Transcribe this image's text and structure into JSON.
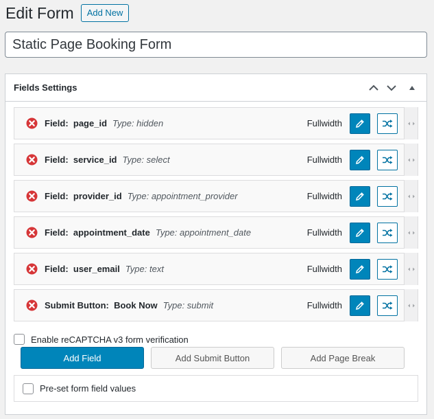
{
  "header": {
    "title": "Edit Form",
    "add_new_label": "Add New"
  },
  "form_name": {
    "value": "Static Page Booking Form"
  },
  "fields_panel": {
    "title": "Fields Settings",
    "icons": [
      "chevron-up-icon",
      "chevron-down-icon",
      "toggle-triangle-icon"
    ]
  },
  "fields": [
    {
      "label": "Field:  page_id",
      "type": "Type: hidden",
      "width": "Fullwidth"
    },
    {
      "label": "Field:  service_id",
      "type": "Type: select",
      "width": "Fullwidth"
    },
    {
      "label": "Field:  provider_id",
      "type": "Type: appointment_provider",
      "width": "Fullwidth"
    },
    {
      "label": "Field:  appointment_date",
      "type": "Type: appointment_date",
      "width": "Fullwidth"
    },
    {
      "label": "Field:  user_email",
      "type": "Type: text",
      "width": "Fullwidth"
    },
    {
      "label": "Submit Button:  Book Now",
      "type": "Type: submit",
      "width": "Fullwidth"
    }
  ],
  "recaptcha": {
    "label": "Enable reCAPTCHA v3 form verification",
    "checked": false
  },
  "buttons": {
    "add_field": "Add Field",
    "add_submit": "Add Submit Button",
    "add_page_break": "Add Page Break"
  },
  "preset": {
    "label": "Pre-set form field values",
    "checked": false
  },
  "colors": {
    "primary": "#0085ba",
    "remove": "#d63638",
    "outline": "#0071a1"
  }
}
